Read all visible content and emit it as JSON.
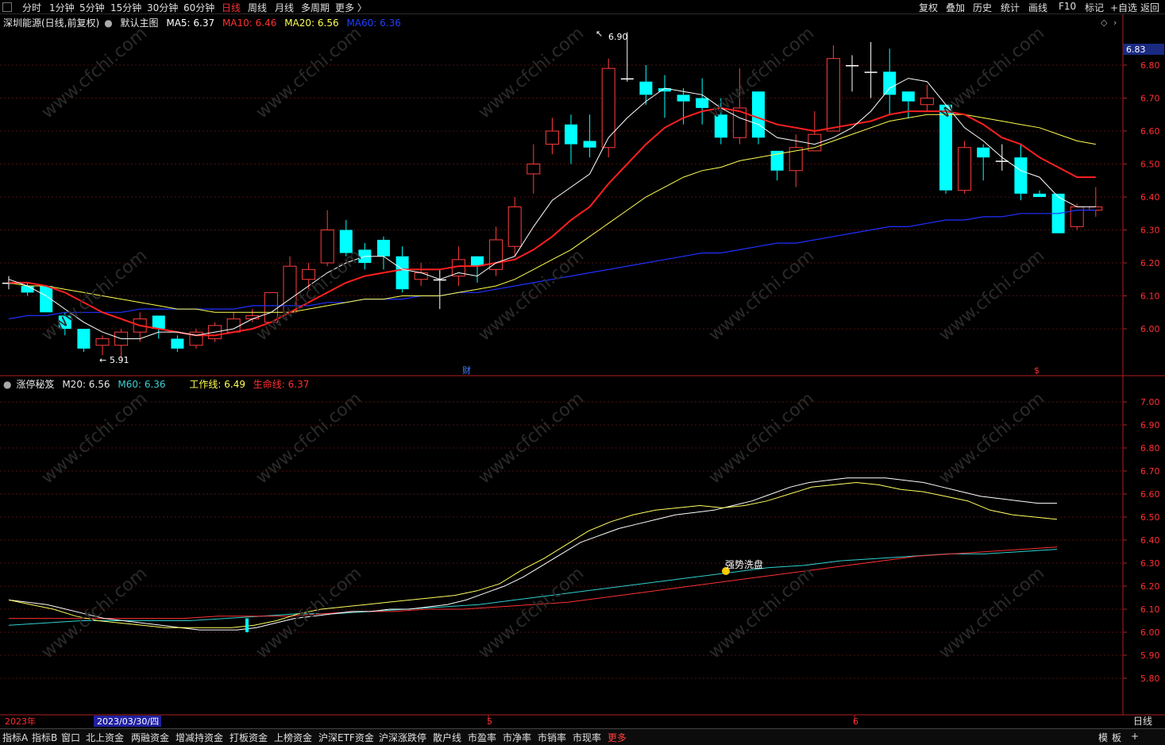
{
  "toolbar": {
    "periods": [
      "分时",
      "1分钟",
      "5分钟",
      "15分钟",
      "30分钟",
      "60分钟",
      "日线",
      "周线",
      "月线",
      "多周期",
      "更多 〉"
    ],
    "active_period": "日线",
    "right_items": [
      "复权",
      "叠加",
      "历史",
      "统计",
      "画线",
      "F10",
      "标记",
      "+自选",
      "返回"
    ]
  },
  "main_panel": {
    "stock_title": "深圳能源(日线,前复权)",
    "template_label": "默认主图",
    "ma5": "MA5: 6.37",
    "ma10": "MA10: 6.46",
    "ma20": "MA20: 6.56",
    "ma60": "MA60: 6.36",
    "price_tag": "6.83",
    "high_marker": "6.90",
    "low_marker": "5.91",
    "fin_marker": "财",
    "dollar_marker": "$",
    "axis_ticks": [
      "6.80",
      "6.70",
      "6.60",
      "6.50",
      "6.40",
      "6.30",
      "6.20",
      "6.10",
      "6.00"
    ]
  },
  "indicator_panel": {
    "name": "涨停秘笈",
    "m20": "M20: 6.56",
    "m60": "M60: 6.36",
    "work_line": "工作线: 6.49",
    "life_line": "生命线: 6.37",
    "annotation": "强势洗盘",
    "axis_ticks": [
      "7.00",
      "6.90",
      "6.80",
      "6.70",
      "6.60",
      "6.50",
      "6.40",
      "6.30",
      "6.20",
      "6.10",
      "6.00",
      "5.90",
      "5.80"
    ]
  },
  "time_axis": {
    "year_label": "2023年",
    "cursor_date": "2023/03/30/四",
    "month_5": "5",
    "month_6": "6",
    "period_label": "日线"
  },
  "bottom_tabs": [
    "指标A",
    "指标B",
    "窗口",
    "北上资金",
    "两融资金",
    "增减持资金",
    "打板资金",
    "上榜资金",
    "沪深ETF资金",
    "沪深涨跌停",
    "散户线",
    "市盈率",
    "市净率",
    "市销率",
    "市现率",
    "更多"
  ],
  "bottom_right": [
    "模",
    "板",
    "+"
  ],
  "colors": {
    "up": "#ff3c3c",
    "down": "#00ffff",
    "ma5": "#ffffff",
    "ma10": "#ff2020",
    "ma20": "#ffff50",
    "ma60": "#2030ff",
    "axis": "#ff3030"
  },
  "chart_data": {
    "type": "candlestick",
    "candles": [
      [
        6.14,
        6.14,
        6.16,
        6.12
      ],
      [
        6.13,
        6.11,
        6.14,
        6.1
      ],
      [
        6.13,
        6.05,
        6.13,
        6.05
      ],
      [
        6.04,
        6.0,
        6.05,
        5.98
      ],
      [
        6.0,
        5.94,
        6.0,
        5.93
      ],
      [
        5.95,
        5.97,
        5.98,
        5.92
      ],
      [
        5.95,
        5.99,
        6.0,
        5.91
      ],
      [
        5.99,
        6.03,
        6.05,
        5.96
      ],
      [
        6.04,
        6.0,
        6.04,
        5.97
      ],
      [
        5.97,
        5.94,
        5.98,
        5.93
      ],
      [
        5.95,
        5.99,
        6.0,
        5.94
      ],
      [
        5.97,
        6.01,
        6.02,
        5.96
      ],
      [
        5.99,
        6.03,
        6.05,
        5.99
      ],
      [
        6.03,
        6.04,
        6.06,
        6.02
      ],
      [
        6.02,
        6.11,
        6.11,
        6.02
      ],
      [
        6.05,
        6.19,
        6.22,
        6.05
      ],
      [
        6.15,
        6.18,
        6.2,
        6.12
      ],
      [
        6.2,
        6.3,
        6.36,
        6.19
      ],
      [
        6.3,
        6.23,
        6.33,
        6.22
      ],
      [
        6.24,
        6.2,
        6.26,
        6.18
      ],
      [
        6.27,
        6.22,
        6.28,
        6.18
      ],
      [
        6.22,
        6.12,
        6.25,
        6.11
      ],
      [
        6.15,
        6.17,
        6.2,
        6.13
      ],
      [
        6.15,
        6.15,
        6.18,
        6.06
      ],
      [
        6.16,
        6.21,
        6.25,
        6.13
      ],
      [
        6.22,
        6.19,
        6.22,
        6.14
      ],
      [
        6.18,
        6.27,
        6.31,
        6.16
      ],
      [
        6.25,
        6.37,
        6.4,
        6.22
      ],
      [
        6.47,
        6.5,
        6.56,
        6.41
      ],
      [
        6.56,
        6.6,
        6.64,
        6.53
      ],
      [
        6.62,
        6.56,
        6.65,
        6.5
      ],
      [
        6.57,
        6.55,
        6.65,
        6.52
      ],
      [
        6.55,
        6.79,
        6.82,
        6.52
      ],
      [
        6.76,
        6.76,
        6.9,
        6.75
      ],
      [
        6.75,
        6.71,
        6.8,
        6.68
      ],
      [
        6.73,
        6.72,
        6.77,
        6.64
      ],
      [
        6.71,
        6.69,
        6.73,
        6.62
      ],
      [
        6.7,
        6.67,
        6.76,
        6.62
      ],
      [
        6.65,
        6.58,
        6.7,
        6.56
      ],
      [
        6.58,
        6.67,
        6.79,
        6.56
      ],
      [
        6.72,
        6.58,
        6.72,
        6.56
      ],
      [
        6.54,
        6.48,
        6.54,
        6.45
      ],
      [
        6.48,
        6.55,
        6.59,
        6.43
      ],
      [
        6.54,
        6.59,
        6.66,
        6.54
      ],
      [
        6.6,
        6.82,
        6.86,
        6.6
      ],
      [
        6.8,
        6.8,
        6.83,
        6.72
      ],
      [
        6.78,
        6.78,
        6.87,
        6.7
      ],
      [
        6.78,
        6.71,
        6.85,
        6.65
      ],
      [
        6.72,
        6.69,
        6.72,
        6.64
      ],
      [
        6.68,
        6.7,
        6.74,
        6.66
      ],
      [
        6.68,
        6.42,
        6.68,
        6.41
      ],
      [
        6.42,
        6.55,
        6.57,
        6.41
      ],
      [
        6.55,
        6.52,
        6.56,
        6.45
      ],
      [
        6.51,
        6.51,
        6.56,
        6.48
      ],
      [
        6.52,
        6.41,
        6.56,
        6.39
      ],
      [
        6.41,
        6.4,
        6.42,
        6.4
      ],
      [
        6.41,
        6.29,
        6.41,
        6.29
      ],
      [
        6.31,
        6.37,
        6.38,
        6.3
      ],
      [
        6.36,
        6.37,
        6.43,
        6.34
      ]
    ],
    "ma5": [
      6.15,
      6.13,
      6.1,
      6.06,
      6.02,
      5.99,
      5.97,
      5.97,
      5.99,
      5.99,
      5.98,
      5.99,
      6.0,
      6.03,
      6.05,
      6.09,
      6.13,
      6.17,
      6.2,
      6.22,
      6.22,
      6.18,
      6.17,
      6.15,
      6.17,
      6.16,
      6.2,
      6.22,
      6.31,
      6.39,
      6.43,
      6.47,
      6.58,
      6.64,
      6.69,
      6.73,
      6.72,
      6.71,
      6.67,
      6.64,
      6.62,
      6.58,
      6.57,
      6.56,
      6.58,
      6.61,
      6.66,
      6.73,
      6.76,
      6.75,
      6.68,
      6.61,
      6.57,
      6.52,
      6.48,
      6.46,
      6.4,
      6.37,
      6.37
    ],
    "ma10": [
      6.14,
      6.14,
      6.13,
      6.11,
      6.08,
      6.05,
      6.03,
      6.01,
      6.0,
      5.99,
      5.98,
      5.98,
      5.99,
      6.0,
      6.02,
      6.05,
      6.08,
      6.11,
      6.14,
      6.16,
      6.17,
      6.18,
      6.18,
      6.18,
      6.19,
      6.19,
      6.2,
      6.21,
      6.24,
      6.28,
      6.33,
      6.37,
      6.44,
      6.5,
      6.56,
      6.61,
      6.64,
      6.66,
      6.67,
      6.66,
      6.64,
      6.62,
      6.61,
      6.6,
      6.61,
      6.62,
      6.63,
      6.65,
      6.66,
      6.66,
      6.66,
      6.65,
      6.62,
      6.58,
      6.56,
      6.52,
      6.49,
      6.46,
      6.46
    ],
    "ma20": [
      6.14,
      6.13,
      6.13,
      6.12,
      6.11,
      6.1,
      6.09,
      6.08,
      6.07,
      6.06,
      6.06,
      6.05,
      6.05,
      6.05,
      6.05,
      6.05,
      6.06,
      6.07,
      6.08,
      6.09,
      6.09,
      6.1,
      6.1,
      6.1,
      6.11,
      6.12,
      6.13,
      6.15,
      6.18,
      6.21,
      6.24,
      6.28,
      6.32,
      6.36,
      6.4,
      6.43,
      6.46,
      6.48,
      6.49,
      6.51,
      6.52,
      6.53,
      6.54,
      6.55,
      6.57,
      6.59,
      6.61,
      6.63,
      6.64,
      6.65,
      6.65,
      6.65,
      6.64,
      6.63,
      6.62,
      6.61,
      6.59,
      6.57,
      6.56
    ],
    "ma60": [
      6.03,
      6.04,
      6.04,
      6.05,
      6.05,
      6.05,
      6.05,
      6.06,
      6.06,
      6.06,
      6.06,
      6.06,
      6.06,
      6.07,
      6.07,
      6.07,
      6.07,
      6.08,
      6.08,
      6.09,
      6.09,
      6.09,
      6.1,
      6.1,
      6.11,
      6.11,
      6.12,
      6.13,
      6.14,
      6.15,
      6.16,
      6.17,
      6.18,
      6.19,
      6.2,
      6.21,
      6.22,
      6.23,
      6.23,
      6.24,
      6.25,
      6.26,
      6.26,
      6.27,
      6.28,
      6.29,
      6.3,
      6.31,
      6.31,
      6.32,
      6.33,
      6.33,
      6.34,
      6.34,
      6.35,
      6.35,
      6.35,
      6.36,
      6.36
    ],
    "ind_white": [
      6.14,
      6.13,
      6.12,
      6.1,
      6.08,
      6.06,
      6.05,
      6.04,
      6.03,
      6.02,
      6.01,
      6.01,
      6.01,
      6.02,
      6.04,
      6.06,
      6.07,
      6.08,
      6.09,
      6.09,
      6.1,
      6.1,
      6.11,
      6.12,
      6.14,
      6.17,
      6.2,
      6.24,
      6.29,
      6.34,
      6.39,
      6.42,
      6.45,
      6.47,
      6.49,
      6.51,
      6.52,
      6.53,
      6.55,
      6.57,
      6.6,
      6.63,
      6.65,
      6.66,
      6.67,
      6.67,
      6.67,
      6.66,
      6.65,
      6.63,
      6.61,
      6.59,
      6.58,
      6.57,
      6.56,
      6.56
    ],
    "ind_yellow": [
      6.14,
      6.12,
      6.1,
      6.07,
      6.05,
      6.04,
      6.03,
      6.02,
      6.02,
      6.02,
      6.02,
      6.03,
      6.05,
      6.08,
      6.1,
      6.11,
      6.12,
      6.13,
      6.14,
      6.15,
      6.16,
      6.18,
      6.21,
      6.27,
      6.32,
      6.38,
      6.44,
      6.48,
      6.51,
      6.53,
      6.54,
      6.55,
      6.54,
      6.55,
      6.57,
      6.6,
      6.63,
      6.64,
      6.65,
      6.64,
      6.62,
      6.61,
      6.59,
      6.57,
      6.53,
      6.51,
      6.5,
      6.49
    ],
    "ind_red": [
      6.06,
      6.06,
      6.06,
      6.06,
      6.06,
      6.06,
      6.07,
      6.07,
      6.07,
      6.08,
      6.09,
      6.09,
      6.1,
      6.1,
      6.11,
      6.12,
      6.13,
      6.15,
      6.17,
      6.19,
      6.21,
      6.23,
      6.25,
      6.27,
      6.29,
      6.31,
      6.33,
      6.34,
      6.35,
      6.36,
      6.37
    ],
    "ind_cyan": [
      6.03,
      6.04,
      6.05,
      6.05,
      6.05,
      6.05,
      6.06,
      6.07,
      6.08,
      6.08,
      6.09,
      6.1,
      6.11,
      6.12,
      6.14,
      6.16,
      6.18,
      6.2,
      6.22,
      6.24,
      6.26,
      6.28,
      6.29,
      6.31,
      6.32,
      6.33,
      6.34,
      6.34,
      6.35,
      6.36
    ]
  }
}
